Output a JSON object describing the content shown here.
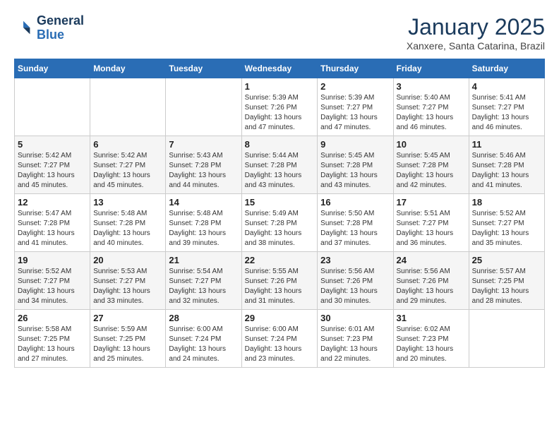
{
  "logo": {
    "line1": "General",
    "line2": "Blue"
  },
  "title": "January 2025",
  "subtitle": "Xanxere, Santa Catarina, Brazil",
  "days_of_week": [
    "Sunday",
    "Monday",
    "Tuesday",
    "Wednesday",
    "Thursday",
    "Friday",
    "Saturday"
  ],
  "weeks": [
    [
      {
        "day": "",
        "info": ""
      },
      {
        "day": "",
        "info": ""
      },
      {
        "day": "",
        "info": ""
      },
      {
        "day": "1",
        "info": "Sunrise: 5:39 AM\nSunset: 7:26 PM\nDaylight: 13 hours\nand 47 minutes."
      },
      {
        "day": "2",
        "info": "Sunrise: 5:39 AM\nSunset: 7:27 PM\nDaylight: 13 hours\nand 47 minutes."
      },
      {
        "day": "3",
        "info": "Sunrise: 5:40 AM\nSunset: 7:27 PM\nDaylight: 13 hours\nand 46 minutes."
      },
      {
        "day": "4",
        "info": "Sunrise: 5:41 AM\nSunset: 7:27 PM\nDaylight: 13 hours\nand 46 minutes."
      }
    ],
    [
      {
        "day": "5",
        "info": "Sunrise: 5:42 AM\nSunset: 7:27 PM\nDaylight: 13 hours\nand 45 minutes."
      },
      {
        "day": "6",
        "info": "Sunrise: 5:42 AM\nSunset: 7:27 PM\nDaylight: 13 hours\nand 45 minutes."
      },
      {
        "day": "7",
        "info": "Sunrise: 5:43 AM\nSunset: 7:28 PM\nDaylight: 13 hours\nand 44 minutes."
      },
      {
        "day": "8",
        "info": "Sunrise: 5:44 AM\nSunset: 7:28 PM\nDaylight: 13 hours\nand 43 minutes."
      },
      {
        "day": "9",
        "info": "Sunrise: 5:45 AM\nSunset: 7:28 PM\nDaylight: 13 hours\nand 43 minutes."
      },
      {
        "day": "10",
        "info": "Sunrise: 5:45 AM\nSunset: 7:28 PM\nDaylight: 13 hours\nand 42 minutes."
      },
      {
        "day": "11",
        "info": "Sunrise: 5:46 AM\nSunset: 7:28 PM\nDaylight: 13 hours\nand 41 minutes."
      }
    ],
    [
      {
        "day": "12",
        "info": "Sunrise: 5:47 AM\nSunset: 7:28 PM\nDaylight: 13 hours\nand 41 minutes."
      },
      {
        "day": "13",
        "info": "Sunrise: 5:48 AM\nSunset: 7:28 PM\nDaylight: 13 hours\nand 40 minutes."
      },
      {
        "day": "14",
        "info": "Sunrise: 5:48 AM\nSunset: 7:28 PM\nDaylight: 13 hours\nand 39 minutes."
      },
      {
        "day": "15",
        "info": "Sunrise: 5:49 AM\nSunset: 7:28 PM\nDaylight: 13 hours\nand 38 minutes."
      },
      {
        "day": "16",
        "info": "Sunrise: 5:50 AM\nSunset: 7:28 PM\nDaylight: 13 hours\nand 37 minutes."
      },
      {
        "day": "17",
        "info": "Sunrise: 5:51 AM\nSunset: 7:27 PM\nDaylight: 13 hours\nand 36 minutes."
      },
      {
        "day": "18",
        "info": "Sunrise: 5:52 AM\nSunset: 7:27 PM\nDaylight: 13 hours\nand 35 minutes."
      }
    ],
    [
      {
        "day": "19",
        "info": "Sunrise: 5:52 AM\nSunset: 7:27 PM\nDaylight: 13 hours\nand 34 minutes."
      },
      {
        "day": "20",
        "info": "Sunrise: 5:53 AM\nSunset: 7:27 PM\nDaylight: 13 hours\nand 33 minutes."
      },
      {
        "day": "21",
        "info": "Sunrise: 5:54 AM\nSunset: 7:27 PM\nDaylight: 13 hours\nand 32 minutes."
      },
      {
        "day": "22",
        "info": "Sunrise: 5:55 AM\nSunset: 7:26 PM\nDaylight: 13 hours\nand 31 minutes."
      },
      {
        "day": "23",
        "info": "Sunrise: 5:56 AM\nSunset: 7:26 PM\nDaylight: 13 hours\nand 30 minutes."
      },
      {
        "day": "24",
        "info": "Sunrise: 5:56 AM\nSunset: 7:26 PM\nDaylight: 13 hours\nand 29 minutes."
      },
      {
        "day": "25",
        "info": "Sunrise: 5:57 AM\nSunset: 7:25 PM\nDaylight: 13 hours\nand 28 minutes."
      }
    ],
    [
      {
        "day": "26",
        "info": "Sunrise: 5:58 AM\nSunset: 7:25 PM\nDaylight: 13 hours\nand 27 minutes."
      },
      {
        "day": "27",
        "info": "Sunrise: 5:59 AM\nSunset: 7:25 PM\nDaylight: 13 hours\nand 25 minutes."
      },
      {
        "day": "28",
        "info": "Sunrise: 6:00 AM\nSunset: 7:24 PM\nDaylight: 13 hours\nand 24 minutes."
      },
      {
        "day": "29",
        "info": "Sunrise: 6:00 AM\nSunset: 7:24 PM\nDaylight: 13 hours\nand 23 minutes."
      },
      {
        "day": "30",
        "info": "Sunrise: 6:01 AM\nSunset: 7:23 PM\nDaylight: 13 hours\nand 22 minutes."
      },
      {
        "day": "31",
        "info": "Sunrise: 6:02 AM\nSunset: 7:23 PM\nDaylight: 13 hours\nand 20 minutes."
      },
      {
        "day": "",
        "info": ""
      }
    ]
  ]
}
